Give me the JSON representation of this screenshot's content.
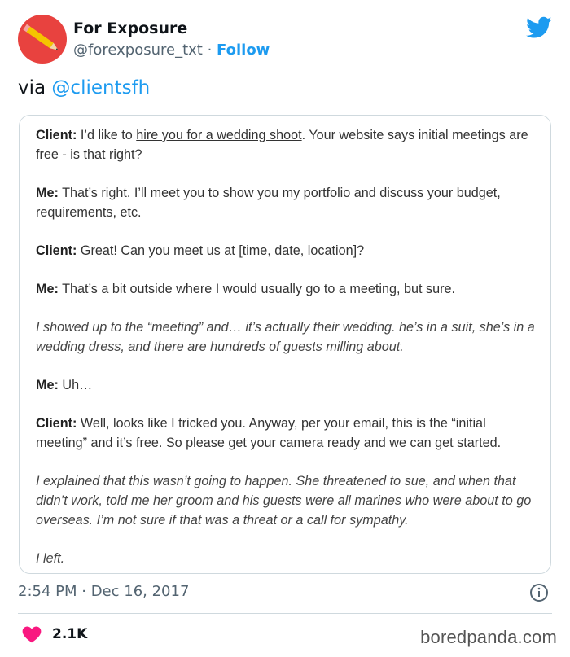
{
  "author": {
    "name": "For Exposure",
    "handle": "@forexposure_txt",
    "separator": "·",
    "follow_label": "Follow"
  },
  "tweet": {
    "via_prefix": "via",
    "via_mention": "@clientsfh"
  },
  "screenshot": {
    "p1_speaker": "Client:",
    "p1_pre": " I’d like to ",
    "p1_link": "hire you for a wedding shoot",
    "p1_post": ". Your website says initial meetings are free - is that right?",
    "p2_speaker": "Me:",
    "p2_text": " That’s right. I’ll meet you to show you my portfolio and discuss your budget, requirements, etc.",
    "p3_speaker": "Client:",
    "p3_text": " Great! Can you meet us at [time, date, location]?",
    "p4_speaker": "Me:",
    "p4_text": " That’s a bit outside where I would usually go to a meeting, but sure.",
    "p5_italic": "I showed up to the “meeting” and… it’s actually their wedding. he’s in a suit, she’s in a wedding dress, and there are hundreds of guests milling about.",
    "p6_speaker": "Me:",
    "p6_text": " Uh…",
    "p7_speaker": "Client:",
    "p7_text": " Well, looks like I tricked you. Anyway, per your email, this is the “initial meeting” and it’s free. So please get your camera ready and we can get started.",
    "p8_italic": "I explained that this wasn’t going to happen. She threatened to sue, and when that didn’t work, told me her groom and his guests were all marines who were about to go overseas. I’m not sure if that was a threat or a call for sympathy.",
    "p9_italic": "I left."
  },
  "meta": {
    "timestamp": "2:54 PM · Dec 16, 2017",
    "likes": "2.1K",
    "watermark": "boredpanda.com"
  },
  "colors": {
    "accent": "#1d9bf0",
    "like_red": "#f91880",
    "avatar_red": "#e8423f"
  },
  "icons": [
    "pencil-logo-icon",
    "twitter-bird-icon",
    "info-icon",
    "heart-icon"
  ]
}
